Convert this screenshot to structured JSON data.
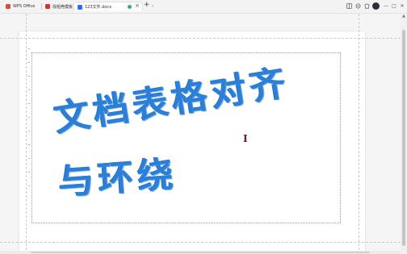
{
  "tabs": [
    {
      "label": "WPS Office"
    },
    {
      "label": "找稻壳模板"
    },
    {
      "label": "123文件.docx"
    }
  ],
  "tab_controls": {
    "new_tab": "+",
    "tab_list": "⌄"
  },
  "window_controls": {
    "minimize": "—",
    "maximize": "□",
    "close": "✕"
  },
  "document": {
    "wordart_line1": "文档表格对齐",
    "wordart_line2": "与环绕",
    "cursor": "I"
  },
  "colors": {
    "wordart": "#2b7fd6",
    "doc_tab_icon": "#2e6ff2",
    "wps_icon": "#e2483f"
  }
}
